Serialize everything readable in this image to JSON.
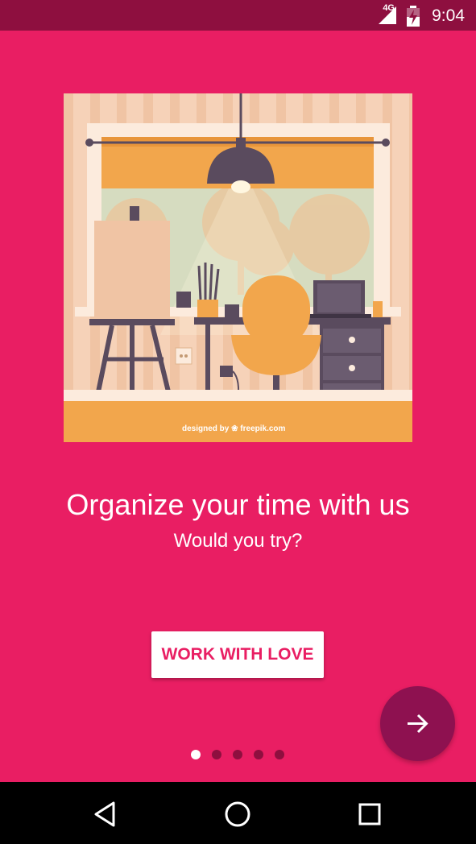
{
  "status_bar": {
    "network": "4G",
    "time": "9:04"
  },
  "illustration": {
    "credit": "designed by ❀ freepik.com"
  },
  "onboarding": {
    "title": "Organize your time with us",
    "subtitle": "Would you try?",
    "button_label": "WORK WITH LOVE",
    "page_count": 5,
    "current_page": 1
  },
  "colors": {
    "background": "#E91E63",
    "status_bar": "#8E0F3F",
    "fab": "#8E1150",
    "button_text": "#E91E63"
  },
  "icons": {
    "fab": "arrow-forward-icon",
    "nav_back": "back-triangle-icon",
    "nav_home": "home-circle-icon",
    "nav_recents": "recents-square-icon"
  }
}
